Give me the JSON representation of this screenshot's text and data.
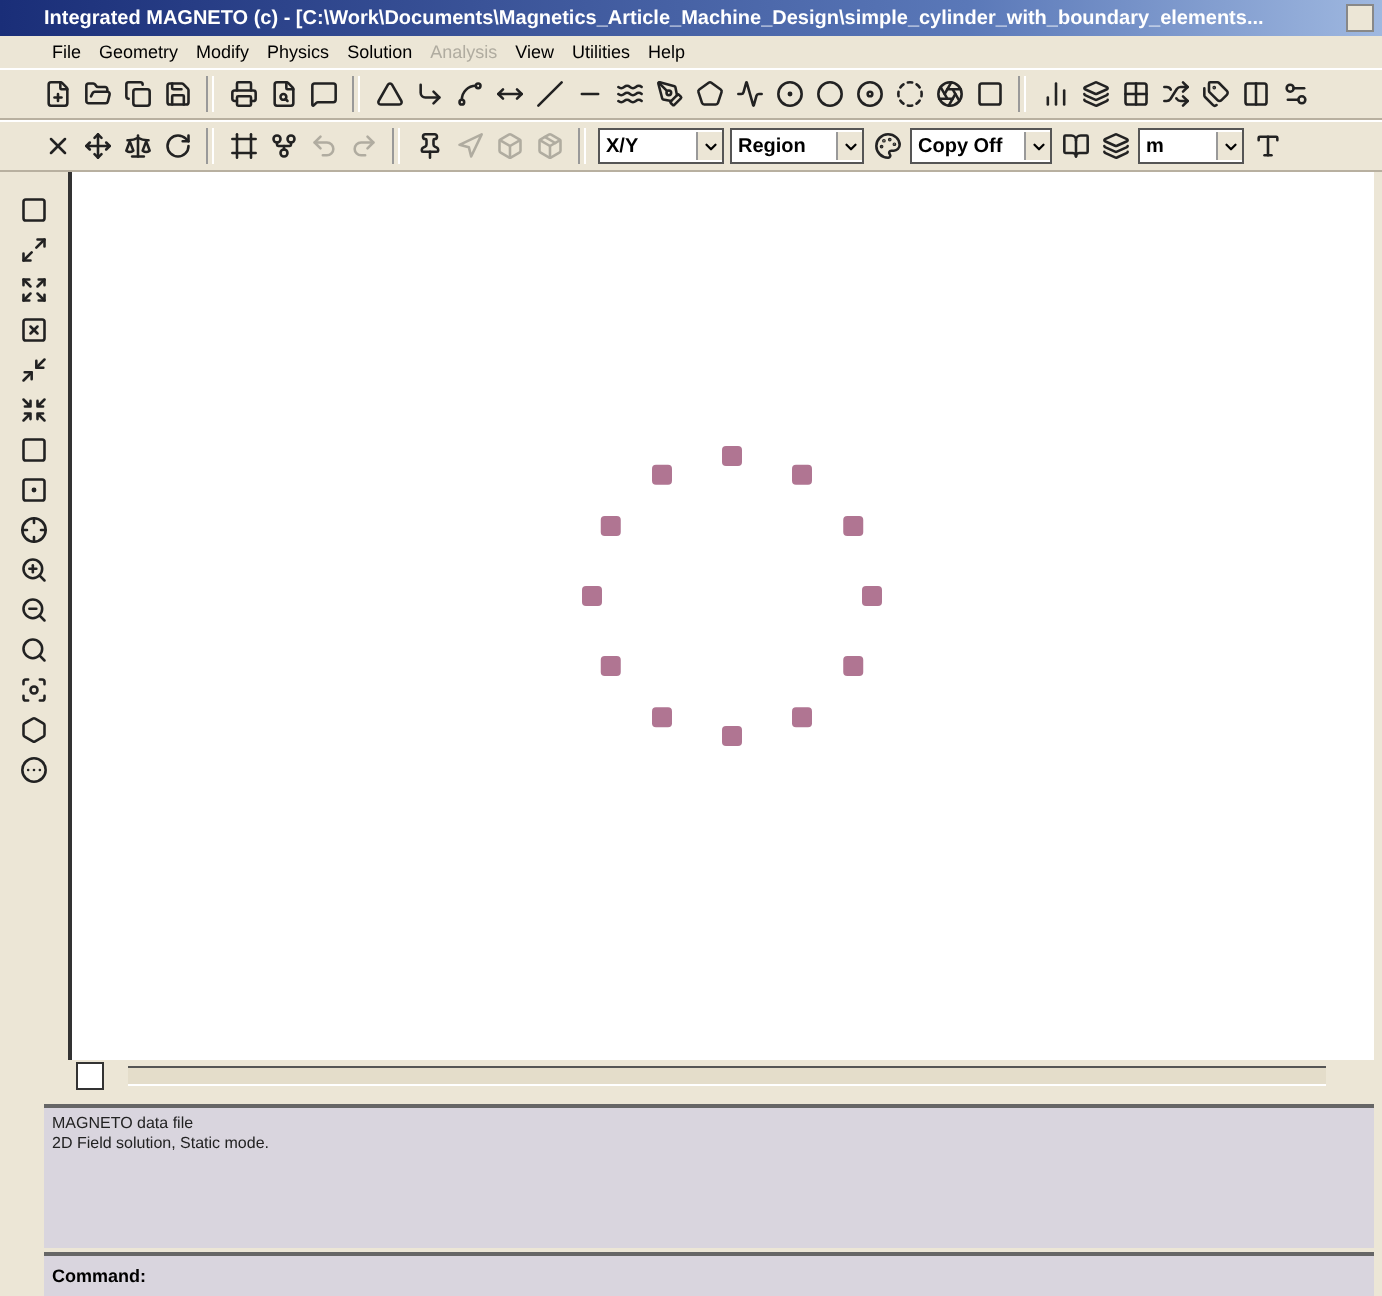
{
  "window": {
    "title": "Integrated MAGNETO (c) - [C:\\Work\\Documents\\Magnetics_Article_Machine_Design\\simple_cylinder_with_boundary_elements..."
  },
  "menu": [
    {
      "label": "File",
      "disabled": false
    },
    {
      "label": "Geometry",
      "disabled": false
    },
    {
      "label": "Modify",
      "disabled": false
    },
    {
      "label": "Physics",
      "disabled": false
    },
    {
      "label": "Solution",
      "disabled": false
    },
    {
      "label": "Analysis",
      "disabled": true
    },
    {
      "label": "View",
      "disabled": false
    },
    {
      "label": "Utilities",
      "disabled": false
    },
    {
      "label": "Help",
      "disabled": false
    }
  ],
  "toolbar": {
    "plane": "X/Y",
    "entity": "Region",
    "copy_mode": "Copy Off",
    "units": "m"
  },
  "output": {
    "lines": [
      "MAGNETO data file",
      "2D Field solution, Static mode."
    ]
  },
  "command": {
    "label": "Command:"
  }
}
